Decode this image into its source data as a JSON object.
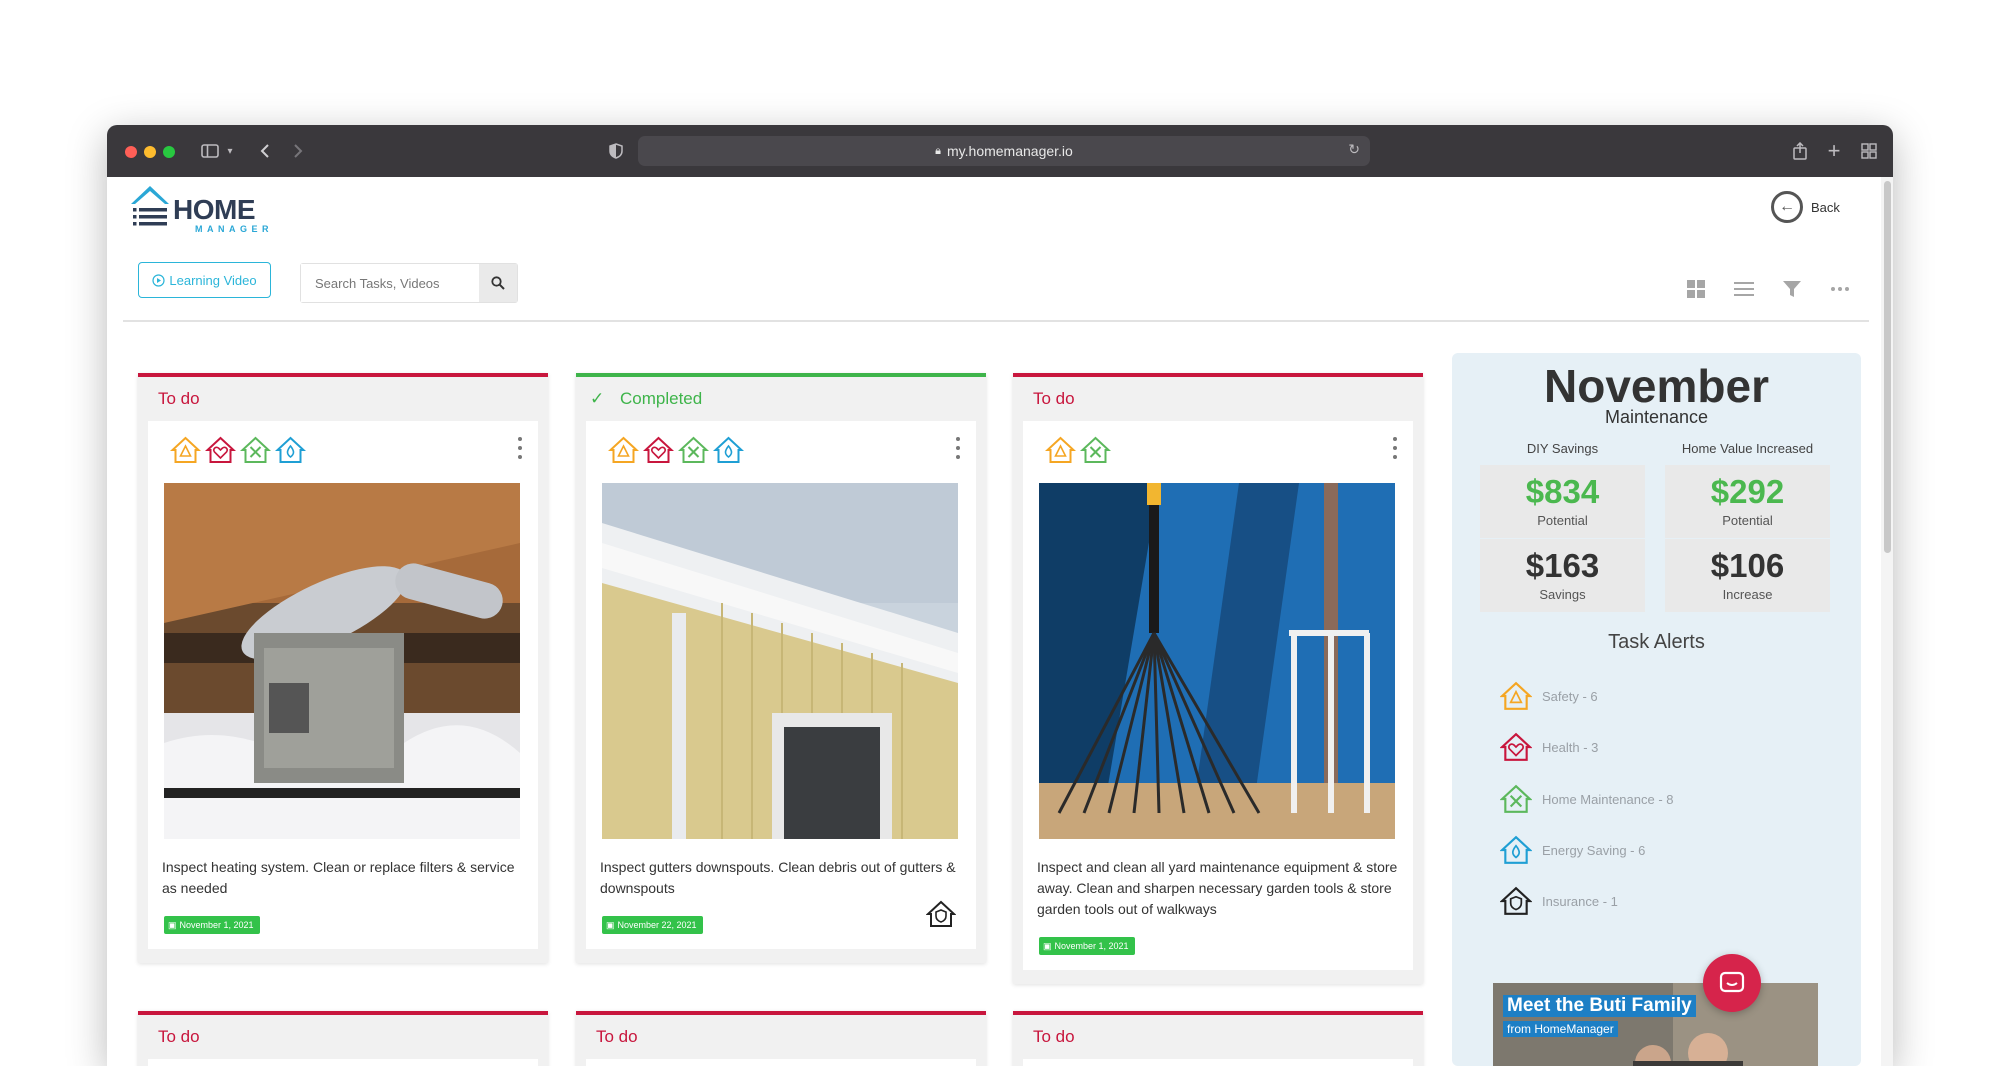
{
  "browser": {
    "url": "my.homemanager.io",
    "traffic_lights": [
      "#ff5f57",
      "#febc2e",
      "#28c840"
    ]
  },
  "header": {
    "logo_text": "HOME",
    "logo_sub": "MANAGER",
    "back_label": "Back"
  },
  "toolbar": {
    "learning_video_label": "Learning Video",
    "search_placeholder": "Search Tasks, Videos"
  },
  "colors": {
    "todo": "#c8163d",
    "completed": "#3eb44a",
    "accent_blue": "#2bb5d9",
    "safety": "#f5a623",
    "health": "#c8163d",
    "maintenance": "#5cb85c",
    "energy": "#1f9fd4",
    "insurance": "#222222"
  },
  "cards": [
    {
      "status": "To do",
      "categories": [
        "safety-icon",
        "health-icon",
        "home-maintenance-icon",
        "energy-saving-icon"
      ],
      "description": "Inspect heating system. Clean or replace filters & service as needed",
      "date": "November 1, 2021"
    },
    {
      "status": "Completed",
      "categories": [
        "safety-icon",
        "health-icon",
        "home-maintenance-icon",
        "energy-saving-icon"
      ],
      "description": "Inspect gutters downspouts. Clean debris out of gutters & downspouts",
      "date": "November 22, 2021"
    },
    {
      "status": "To do",
      "categories": [
        "safety-icon",
        "home-maintenance-icon"
      ],
      "description": "Inspect and clean all yard maintenance equipment & store away. Clean and sharpen necessary garden tools & store garden tools out of walkways",
      "date": "November 1, 2021"
    }
  ],
  "bottom_cards": [
    {
      "status": "To do"
    },
    {
      "status": "To do"
    },
    {
      "status": "To do"
    }
  ],
  "sidebar": {
    "month": "November",
    "subtitle": "Maintenance",
    "diy_label": "DIY Savings",
    "home_value_label": "Home Value Increased",
    "stats": {
      "diy_potential": "$834",
      "diy_potential_label": "Potential",
      "home_potential": "$292",
      "home_potential_label": "Potential",
      "diy_savings": "$163",
      "diy_savings_label": "Savings",
      "home_increase": "$106",
      "home_increase_label": "Increase"
    },
    "alerts_title": "Task Alerts",
    "alerts": [
      {
        "label": "Safety - 6"
      },
      {
        "label": "Health - 3"
      },
      {
        "label": "Home Maintenance - 8"
      },
      {
        "label": "Energy Saving - 6"
      },
      {
        "label": "Insurance - 1"
      }
    ],
    "promo_title": "Meet the Buti Family",
    "promo_sub": "from HomeManager"
  }
}
